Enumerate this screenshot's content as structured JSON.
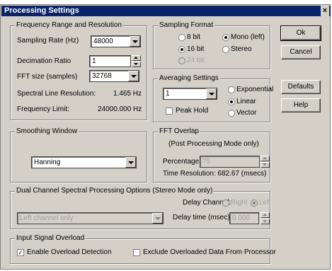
{
  "window": {
    "title": "Processing Settings",
    "close_glyph": "×"
  },
  "freq": {
    "title": "Frequency Range and Resolution",
    "sampling_rate_label": "Sampling Rate (Hz)",
    "sampling_rate_value": "48000",
    "decimation_label": "Decimation Ratio",
    "decimation_value": "1",
    "fft_size_label": "FFT size (samples)",
    "fft_size_value": "32768",
    "spectral_label": "Spectral Line Resolution:",
    "spectral_value": "1.465 Hz",
    "freq_limit_label": "Frequency Limit:",
    "freq_limit_value": "24000.000 Hz"
  },
  "sampling_format": {
    "title": "Sampling Format",
    "opt_8bit": "8 bit",
    "opt_16bit": "16 bit",
    "opt_24bit": "24 bit",
    "opt_mono": "Mono (left)",
    "opt_stereo": "Stereo"
  },
  "averaging": {
    "title": "Averaging Settings",
    "value": "1",
    "peak_hold": "Peak Hold",
    "opt_exponential": "Exponential",
    "opt_linear": "Linear",
    "opt_vector": "Vector"
  },
  "smoothing": {
    "title": "Smoothing Window",
    "value": "Hanning"
  },
  "overlap": {
    "title": "FFT Overlap",
    "note": "(Post Processing Mode only)",
    "percentage_label": "Percentage:",
    "percentage_value": "75",
    "time_resolution": "Time Resolution: 682.67 (msecs)"
  },
  "dual": {
    "title": "Dual Channel Spectral Processing Options (Stereo Mode only)",
    "delay_channel_label": "Delay Channel:",
    "opt_right": "Right",
    "opt_left": "Left",
    "channel_value": "Left channel only",
    "delay_time_label": "Delay time (msec):",
    "delay_time_value": "0.000"
  },
  "overload": {
    "title": "Input Signal Overload",
    "enable": "Enable Overload Detection",
    "exclude": "Exclude Overloaded Data From Processor"
  },
  "buttons": {
    "ok": "Ok",
    "cancel": "Cancel",
    "defaults": "Defaults",
    "help": "Help"
  }
}
